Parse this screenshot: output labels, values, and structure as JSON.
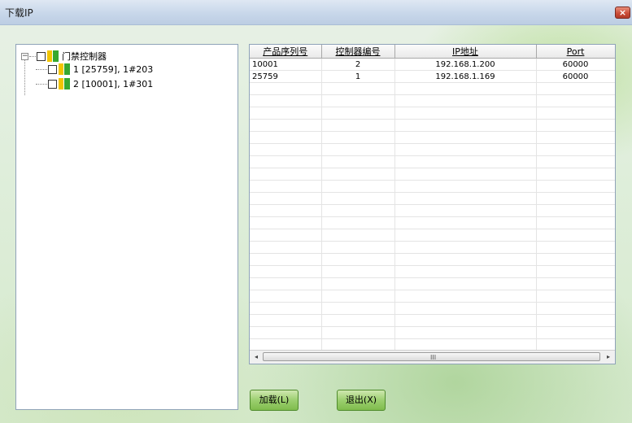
{
  "window": {
    "title": "下载IP",
    "close_glyph": "×"
  },
  "tree": {
    "root": {
      "expander": "⊟",
      "label": "门禁控制器",
      "icon": "controller-icon"
    },
    "children": [
      {
        "label": "1 [25759], 1#203",
        "icon": "controller-icon"
      },
      {
        "label": "2 [10001], 1#301",
        "icon": "controller-icon"
      }
    ]
  },
  "grid": {
    "columns": [
      "产品序列号",
      "控制器编号",
      "IP地址",
      "Port"
    ],
    "rows": [
      [
        "10001",
        "2",
        "192.168.1.200",
        "60000"
      ],
      [
        "25759",
        "1",
        "192.168.1.169",
        "60000"
      ]
    ],
    "scroll_left": "◂",
    "scroll_right": "▸",
    "scroll_grip": "III"
  },
  "buttons": {
    "load": "加载(L)",
    "exit": "退出(X)"
  },
  "colors": {
    "icon_green": "#37a82f",
    "icon_yellow": "#f2c500"
  }
}
